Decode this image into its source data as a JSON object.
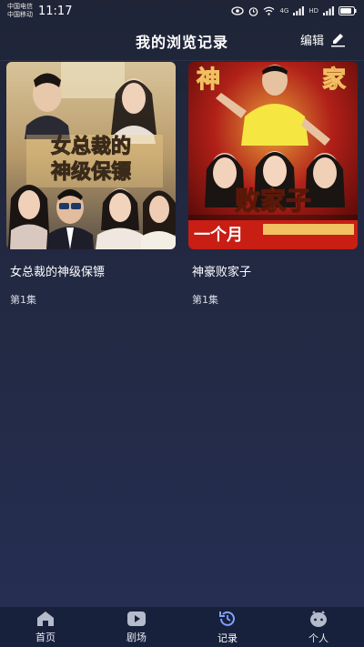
{
  "status_bar": {
    "carrier1": "中国电信",
    "carrier2": "中国移动",
    "time": "11:17",
    "signal_label1": "4G",
    "signal_label2": "HD"
  },
  "header": {
    "title": "我的浏览记录",
    "edit_label": "编辑"
  },
  "history": [
    {
      "title": "女总裁的神级保镖",
      "episode": "第1集",
      "poster_text1": "女总裁的",
      "poster_text2": "神级保镖"
    },
    {
      "title": "神豪败家子",
      "episode": "第1集",
      "poster_text1": "神",
      "poster_text2": "家",
      "poster_text3": "败家子",
      "poster_text4": "一个月"
    }
  ],
  "tabs": [
    {
      "label": "首页",
      "icon": "home-icon"
    },
    {
      "label": "剧场",
      "icon": "play-icon"
    },
    {
      "label": "记录",
      "icon": "history-icon"
    },
    {
      "label": "个人",
      "icon": "profile-icon"
    }
  ],
  "colors": {
    "accent": "#ffffff",
    "tab_bg": "#18213c"
  }
}
